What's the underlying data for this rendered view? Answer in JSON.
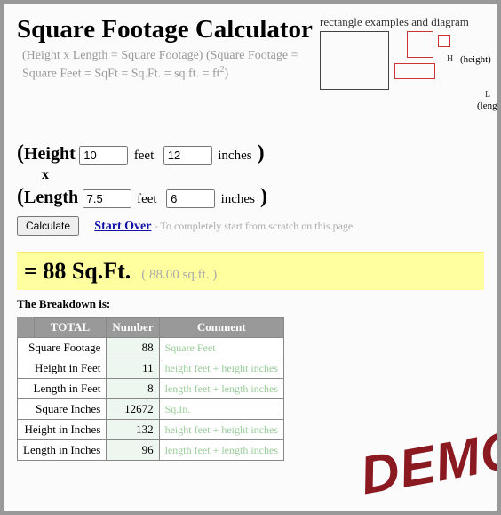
{
  "title": "Square Footage Calculator",
  "subtitle_html": "(Height x Length = Square Footage)\n    (Square Footage = Square Feet = SqFt = Sq.Ft. = sq.ft. = ft",
  "subtitle_sup": "2",
  "subtitle_tail": ")",
  "diagram": {
    "caption": "rectangle examples and diagram",
    "H": "H",
    "L": "L",
    "height": "(height)",
    "length": "(length)"
  },
  "inputs": {
    "open": "(",
    "close": ")",
    "height_label": "Height",
    "length_label": "Length",
    "height_feet": "10",
    "height_inches": "12",
    "length_feet": "7.5",
    "length_inches": "6",
    "feet": "feet",
    "inches": "inches",
    "x": "x"
  },
  "controls": {
    "calculate": "Calculate",
    "start_over": "Start Over",
    "start_over_hint": " - To completely start from scratch on this page"
  },
  "result": {
    "main": "= 88 Sq.Ft.",
    "fine": "( 88.00 sq.ft. )"
  },
  "breakdown_label": "The Breakdown is:",
  "table": {
    "headers": {
      "c1": "TOTAL",
      "c2": "Number",
      "c3": "Comment"
    },
    "rows": [
      {
        "name": "Square Footage",
        "num": "88",
        "comment": "Square Feet"
      },
      {
        "name": "Height in Feet",
        "num": "11",
        "comment": "height feet + height inches"
      },
      {
        "name": "Length in Feet",
        "num": "8",
        "comment": "length feet + length inches"
      },
      {
        "name": "Square Inches",
        "num": "12672",
        "comment": "Sq.In."
      },
      {
        "name": "Height in Inches",
        "num": "132",
        "comment": "height feet + height inches"
      },
      {
        "name": "Length in Inches",
        "num": "96",
        "comment": "length feet + length inches"
      }
    ]
  },
  "watermark": "DEMO"
}
